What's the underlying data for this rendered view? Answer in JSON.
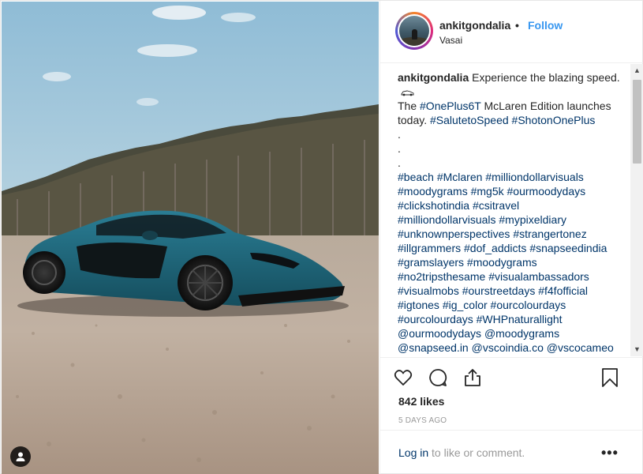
{
  "header": {
    "username": "ankitgondalia",
    "separator": "•",
    "follow_label": "Follow",
    "location": "Vasai"
  },
  "caption": {
    "username": "ankitgondalia",
    "line1": "Experience the blazing speed.",
    "car_icon": "racing-car-emoji",
    "line2_text": "The",
    "line2_tag": "#OnePlus6T",
    "line2_rest": "McLaren Edition launches today.",
    "line2_tags": [
      "#SalutetoSpeed",
      "#ShotonOnePlus"
    ],
    "dots": [
      ".",
      ".",
      "."
    ],
    "hashtags": [
      [
        "#beach",
        "#Mclaren",
        "#milliondollarvisuals"
      ],
      [
        "#moodygrams",
        "#mg5k",
        "#ourmoodydays"
      ],
      [
        "#clickshotindia",
        "#csitravel"
      ],
      [
        "#milliondollarvisuals",
        "#mypixeldiary"
      ],
      [
        "#unknownperspectives",
        "#strangertonez"
      ],
      [
        "#illgrammers",
        "#dof_addicts",
        "#snapseedindia"
      ],
      [
        "#gramslayers",
        "#moodygrams"
      ],
      [
        "#no2tripsthesame",
        "#visualambassadors"
      ],
      [
        "#visualmobs",
        "#ourstreetdays",
        "#f4fofficial"
      ],
      [
        "#igtones",
        "#ig_color",
        "#ourcolourdays"
      ],
      [
        "#ourcolourdays",
        "#WHPnaturallight"
      ],
      [
        "@ourmoodydays",
        "@moodygrams"
      ],
      [
        "@snapseed.in",
        "@vscoindia.co",
        "@vscocameo"
      ]
    ]
  },
  "actions": {
    "like_icon": "heart-icon",
    "comment_icon": "comment-icon",
    "share_icon": "share-icon",
    "save_icon": "bookmark-icon"
  },
  "likes_text": "842 likes",
  "timestamp": "5 DAYS AGO",
  "footer": {
    "login_label": "Log in",
    "login_suffix": " to like or comment.",
    "more_label": "•••"
  },
  "scrollbar": {
    "up": "▲",
    "down": "▼"
  },
  "colors": {
    "link_blue": "#3897f0",
    "hashtag": "#003569",
    "text": "#262626",
    "muted": "#999999",
    "car_body": "#1f6a80"
  }
}
